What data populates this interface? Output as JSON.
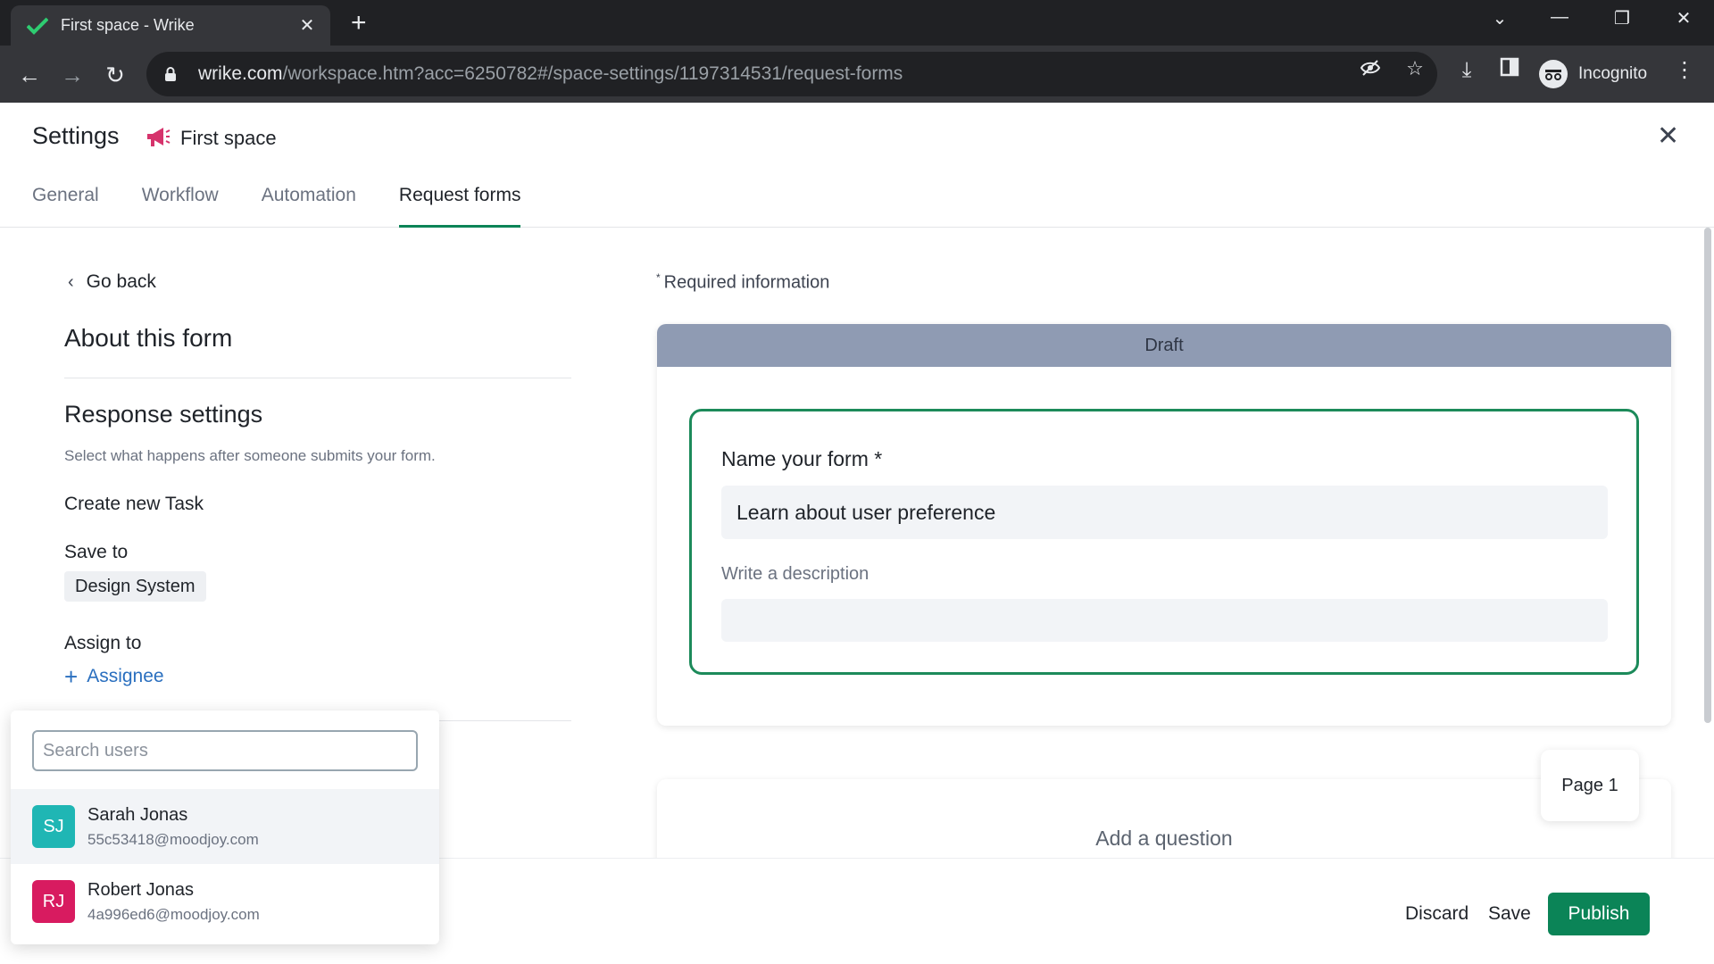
{
  "browser": {
    "tab_title": "First space - Wrike",
    "url_host": "wrike.com",
    "url_path": "/workspace.htm?acc=6250782#/space-settings/1197314531/request-forms",
    "profile_label": "Incognito"
  },
  "header": {
    "title": "Settings",
    "space_name": "First space",
    "tabs": [
      {
        "label": "General"
      },
      {
        "label": "Workflow"
      },
      {
        "label": "Automation"
      },
      {
        "label": "Request forms",
        "active": true
      }
    ]
  },
  "left": {
    "go_back": "Go back",
    "about_title": "About this form",
    "response_title": "Response settings",
    "response_sub": "Select what happens after someone submits your form.",
    "create_label": "Create new Task",
    "save_to_label": "Save to",
    "save_to_value": "Design System",
    "assign_to_label": "Assign to",
    "assignee_button": "Assignee"
  },
  "dropdown": {
    "search_placeholder": "Search users",
    "users": [
      {
        "initials": "SJ",
        "name": "Sarah Jonas",
        "email": "55c53418@moodjoy.com",
        "color": "#1fb6b4"
      },
      {
        "initials": "RJ",
        "name": "Robert Jonas",
        "email": "4a996ed6@moodjoy.com",
        "color": "#d81b60"
      }
    ]
  },
  "form": {
    "required_info": "Required information",
    "status": "Draft",
    "name_label": "Name your form *",
    "name_value": "Learn about user preference",
    "description_label": "Write a description",
    "description_value": "",
    "add_question": "Add a question",
    "page_label": "Page 1"
  },
  "footer": {
    "discard": "Discard",
    "save": "Save",
    "publish": "Publish"
  },
  "colors": {
    "accent": "#0b8457",
    "draft_bar": "#8f9bb3",
    "link": "#2a6fbf",
    "space_icon": "#d6336c"
  }
}
